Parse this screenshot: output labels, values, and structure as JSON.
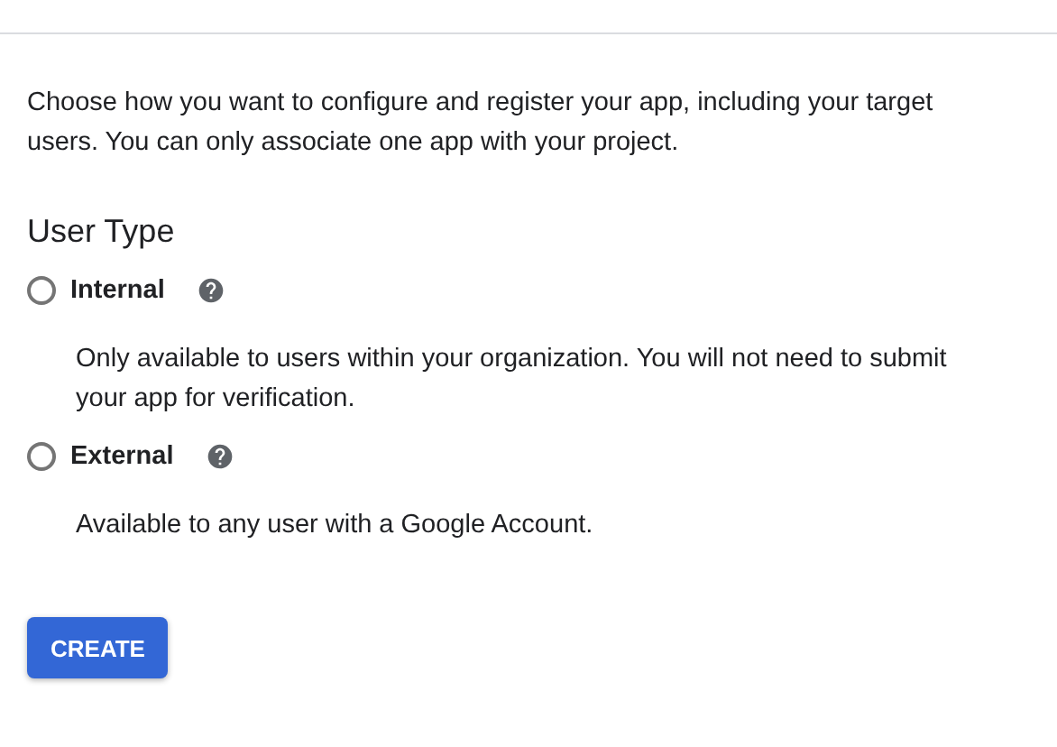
{
  "intro": "Choose how you want to configure and register your app, including your target users. You can only associate one app with your project.",
  "section_title": "User Type",
  "options": [
    {
      "label": "Internal",
      "selected": false,
      "description": "Only available to users within your organization. You will not need to submit your app for verification."
    },
    {
      "label": "External",
      "selected": false,
      "description": "Available to any user with a Google Account."
    }
  ],
  "button": "CREATE"
}
